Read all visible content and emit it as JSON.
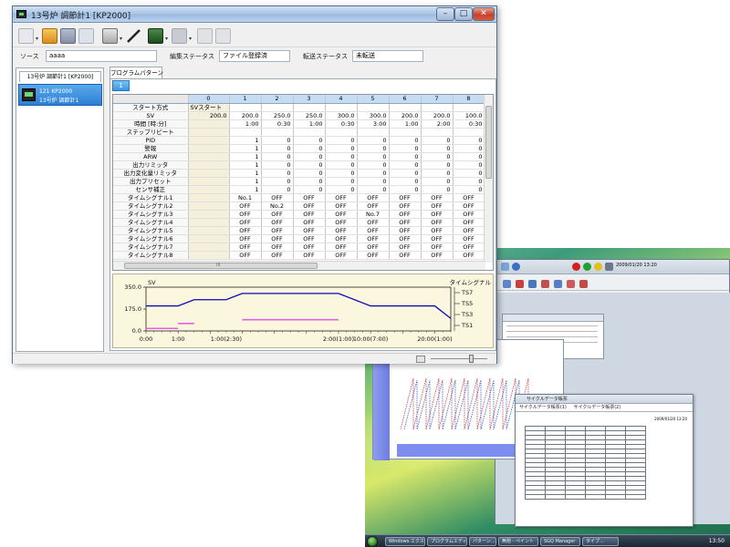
{
  "window": {
    "title": "13号炉 調節計1 [KP2000]",
    "min_glyph": "–",
    "max_glyph": "□",
    "close_glyph": "✕"
  },
  "toolbar": {
    "icons": [
      "new-file",
      "open-folder",
      "save",
      "print-preview",
      "print",
      "edit",
      "transfer-to-device",
      "transfer-from-device",
      "settings",
      "tools"
    ]
  },
  "status": {
    "source_label": "ソース",
    "source_value": "aaaa",
    "edit_status_label": "編集ステータス",
    "edit_status_value": "ファイル登録済",
    "transfer_status_label": "転送ステータス",
    "transfer_status_value": "未転送"
  },
  "left_panel": {
    "tab_label": "13号炉 調節計1 [KP2000]",
    "device_line1": "121 KP2000",
    "device_line2": "13号炉 調節計1"
  },
  "program": {
    "tab_label": "プログラムパターン",
    "pattern_tab": "1",
    "columns": [
      "0",
      "1",
      "2",
      "3",
      "4",
      "5",
      "6",
      "7",
      "8"
    ],
    "rows": [
      {
        "label": "スタート方式",
        "c0": "SVスタート",
        "cells": [
          "",
          "",
          "",
          "",
          "",
          "",
          "",
          ""
        ]
      },
      {
        "label": "SV",
        "c0": "200.0",
        "cells": [
          "200.0",
          "250.0",
          "250.0",
          "300.0",
          "300.0",
          "200.0",
          "200.0",
          "100.0"
        ]
      },
      {
        "label": "時間 [時:分]",
        "c0": "",
        "cells": [
          "1:00",
          "0:30",
          "1:00",
          "0:30",
          "3:00",
          "1:00",
          "2:00",
          "0:30"
        ]
      },
      {
        "label": "ステップリピート",
        "c0": "",
        "cells": [
          "",
          "",
          "",
          "",
          "",
          "",
          "",
          ""
        ]
      },
      {
        "label": "PID",
        "c0": "",
        "cells": [
          "1",
          "0",
          "0",
          "0",
          "0",
          "0",
          "0",
          "0"
        ]
      },
      {
        "label": "警報",
        "c0": "",
        "cells": [
          "1",
          "0",
          "0",
          "0",
          "0",
          "0",
          "0",
          "0"
        ]
      },
      {
        "label": "ARW",
        "c0": "",
        "cells": [
          "1",
          "0",
          "0",
          "0",
          "0",
          "0",
          "0",
          "0"
        ]
      },
      {
        "label": "出力リミッタ",
        "c0": "",
        "cells": [
          "1",
          "0",
          "0",
          "0",
          "0",
          "0",
          "0",
          "0"
        ]
      },
      {
        "label": "出力変化量リミッタ",
        "c0": "",
        "cells": [
          "1",
          "0",
          "0",
          "0",
          "0",
          "0",
          "0",
          "0"
        ]
      },
      {
        "label": "出力プリセット",
        "c0": "",
        "cells": [
          "1",
          "0",
          "0",
          "0",
          "0",
          "0",
          "0",
          "0"
        ]
      },
      {
        "label": "センサ補正",
        "c0": "",
        "cells": [
          "1",
          "0",
          "0",
          "0",
          "0",
          "0",
          "0",
          "0"
        ]
      },
      {
        "label": "タイムシグナル1",
        "c0": "",
        "cells": [
          "No.1",
          "OFF",
          "OFF",
          "OFF",
          "OFF",
          "OFF",
          "OFF",
          "OFF"
        ]
      },
      {
        "label": "タイムシグナル2",
        "c0": "",
        "cells": [
          "OFF",
          "No.2",
          "OFF",
          "OFF",
          "OFF",
          "OFF",
          "OFF",
          "OFF"
        ]
      },
      {
        "label": "タイムシグナル3",
        "c0": "",
        "cells": [
          "OFF",
          "OFF",
          "OFF",
          "OFF",
          "No.7",
          "OFF",
          "OFF",
          "OFF"
        ]
      },
      {
        "label": "タイムシグナル4",
        "c0": "",
        "cells": [
          "OFF",
          "OFF",
          "OFF",
          "OFF",
          "OFF",
          "OFF",
          "OFF",
          "OFF"
        ]
      },
      {
        "label": "タイムシグナル5",
        "c0": "",
        "cells": [
          "OFF",
          "OFF",
          "OFF",
          "OFF",
          "OFF",
          "OFF",
          "OFF",
          "OFF"
        ]
      },
      {
        "label": "タイムシグナル6",
        "c0": "",
        "cells": [
          "OFF",
          "OFF",
          "OFF",
          "OFF",
          "OFF",
          "OFF",
          "OFF",
          "OFF"
        ]
      },
      {
        "label": "タイムシグナル7",
        "c0": "",
        "cells": [
          "OFF",
          "OFF",
          "OFF",
          "OFF",
          "OFF",
          "OFF",
          "OFF",
          "OFF"
        ]
      },
      {
        "label": "タイムシグナル8",
        "c0": "",
        "cells": [
          "OFF",
          "OFF",
          "OFF",
          "OFF",
          "OFF",
          "OFF",
          "OFF",
          "OFF"
        ]
      }
    ],
    "scroll_glyph": "III"
  },
  "chart_data": {
    "type": "line",
    "title": "",
    "ylabel": "SV",
    "right_label": "タイムシグナル",
    "y_ticks": [
      "350.0",
      "175.0",
      "0.0"
    ],
    "ylim": [
      0,
      350
    ],
    "x_ticks": [
      "0:00",
      "1:00",
      "1:00(2:30)",
      "2:00(1:00)",
      "10:00(7:00)",
      "20:00(1:00)"
    ],
    "sv_points_hours": [
      [
        0,
        200
      ],
      [
        1.0,
        200
      ],
      [
        1.5,
        250
      ],
      [
        2.5,
        250
      ],
      [
        3.0,
        300
      ],
      [
        6.0,
        300
      ],
      [
        7.0,
        200
      ],
      [
        9.0,
        200
      ],
      [
        9.5,
        100
      ]
    ],
    "x_max_hours": 9.5,
    "ts_labels": [
      "TS7",
      "TS5",
      "TS3",
      "TS1"
    ],
    "time_signals": [
      {
        "name": "TS1",
        "segments": [
          [
            0,
            1.0
          ]
        ]
      },
      {
        "name": "TS2",
        "segments": [
          [
            1.0,
            1.5
          ]
        ]
      },
      {
        "name": "TS7",
        "segments": [
          [
            3.0,
            6.0
          ]
        ]
      }
    ],
    "colors": {
      "sv": "#0a0ab4",
      "ts": "#e060e0",
      "grid": "#cfd6e8"
    }
  },
  "desktop": {
    "report_title": "サイクルデータ帳票",
    "report_tab1": "サイクルデータ帳票(1)",
    "report_tab2": "サイクルデータ帳票(2)",
    "report_date": "2009/01/20 13:20",
    "bg_date": "2009/01/20 13:20"
  },
  "taskbar": {
    "items": [
      "Windows エクスプ...",
      "プログラムエディ...",
      "パターン...",
      "無題 - ペイント",
      "SGQ Manager",
      "タイプ..."
    ],
    "clock": "13:50"
  }
}
